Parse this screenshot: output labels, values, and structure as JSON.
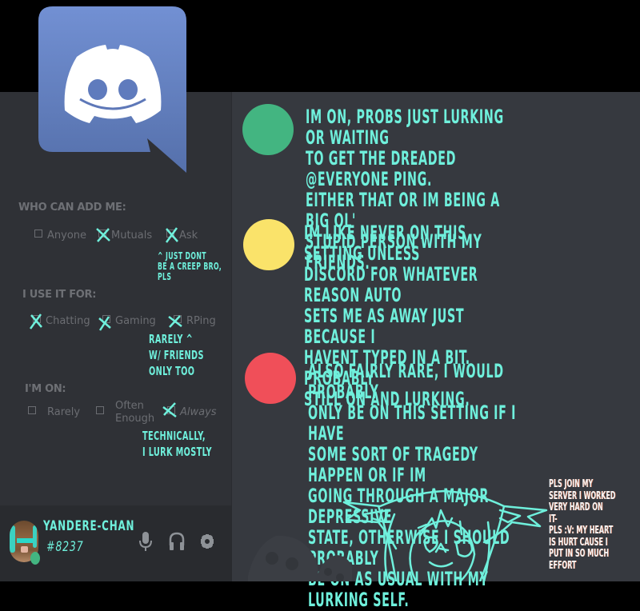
{
  "logo": {
    "icon": "discord-logo-icon",
    "color": "#6f88cc"
  },
  "who_can_add": {
    "heading": "WHO CAN ADD ME:",
    "options": [
      {
        "label": "Anyone",
        "checked": false
      },
      {
        "label": "Mutuals",
        "checked": true
      },
      {
        "label": "Ask",
        "checked": true
      }
    ],
    "note": "^  JUST DONT\nBE A CREEP BRO,\nPLS"
  },
  "use_for": {
    "heading": "I USE IT FOR:",
    "options": [
      {
        "label": "Chatting",
        "checked": true
      },
      {
        "label": "Gaming",
        "checked": true
      },
      {
        "label": "RPing",
        "checked": true
      }
    ],
    "note": "RARELY ^\nW/  FRIENDS\nONLY TOO"
  },
  "im_on": {
    "heading": "I'M ON:",
    "options": [
      {
        "label": "Rarely",
        "checked": false
      },
      {
        "label": "Often\nEnough",
        "checked": false
      },
      {
        "label": "Always",
        "checked": true
      }
    ],
    "note": "TECHNICALLY,\nI LURK MOSTLY"
  },
  "statuses": [
    {
      "status": "online",
      "color": "#43b581",
      "text": "IM ON, PROBS JUST LURKING OR WAITING\nTO GET THE DREADED @EVERYONE PING.\nEITHER THAT OR IM BEING A BIG OL'\nSTUPID PERSON WITH MY FRIENDS."
    },
    {
      "status": "idle",
      "color": "#fae36a",
      "text": "IM LIKE NEVER ON THIS SETTING UNLESS\nDISCORD FOR WHATEVER REASON AUTO\nSETS ME AS AWAY JUST BECAUSE I\nHAVENT TYPED IN A BIT. PROBABLY\nSTILL ON AND LURKING."
    },
    {
      "status": "do-not-disturb",
      "color": "#f04f59",
      "text": "ALSO FAIRLY RARE, I WOULD PROBABLY\nONLY BE ON THIS SETTING IF I HAVE\nSOME SORT OF TRAGEDY HAPPEN OR IF IM\nGOING THROUGH A MAJOR DEPRESSIVE\nSTATE, OTHERWISE I SHOULD PROBABLY\nBE ON AS USUAL WITH MY LURKING SELF."
    }
  ],
  "plug_note": "PLS JOIN MY\nSERVER I WORKED\nVERY HARD ON\nIT-\nPLS :V: MY HEART\nIS HURT CAUSE I\nPUT IN SO MUCH\nEFFORT",
  "user": {
    "name": "YANDERE-CHAN",
    "discriminator": "#8237",
    "status_color": "#43b581",
    "controls": [
      {
        "name": "microphone",
        "icon": "microphone-icon"
      },
      {
        "name": "headphones",
        "icon": "headphones-icon"
      },
      {
        "name": "settings",
        "icon": "gear-icon"
      }
    ]
  },
  "accent_handwriting_color": "#6ff0dc"
}
